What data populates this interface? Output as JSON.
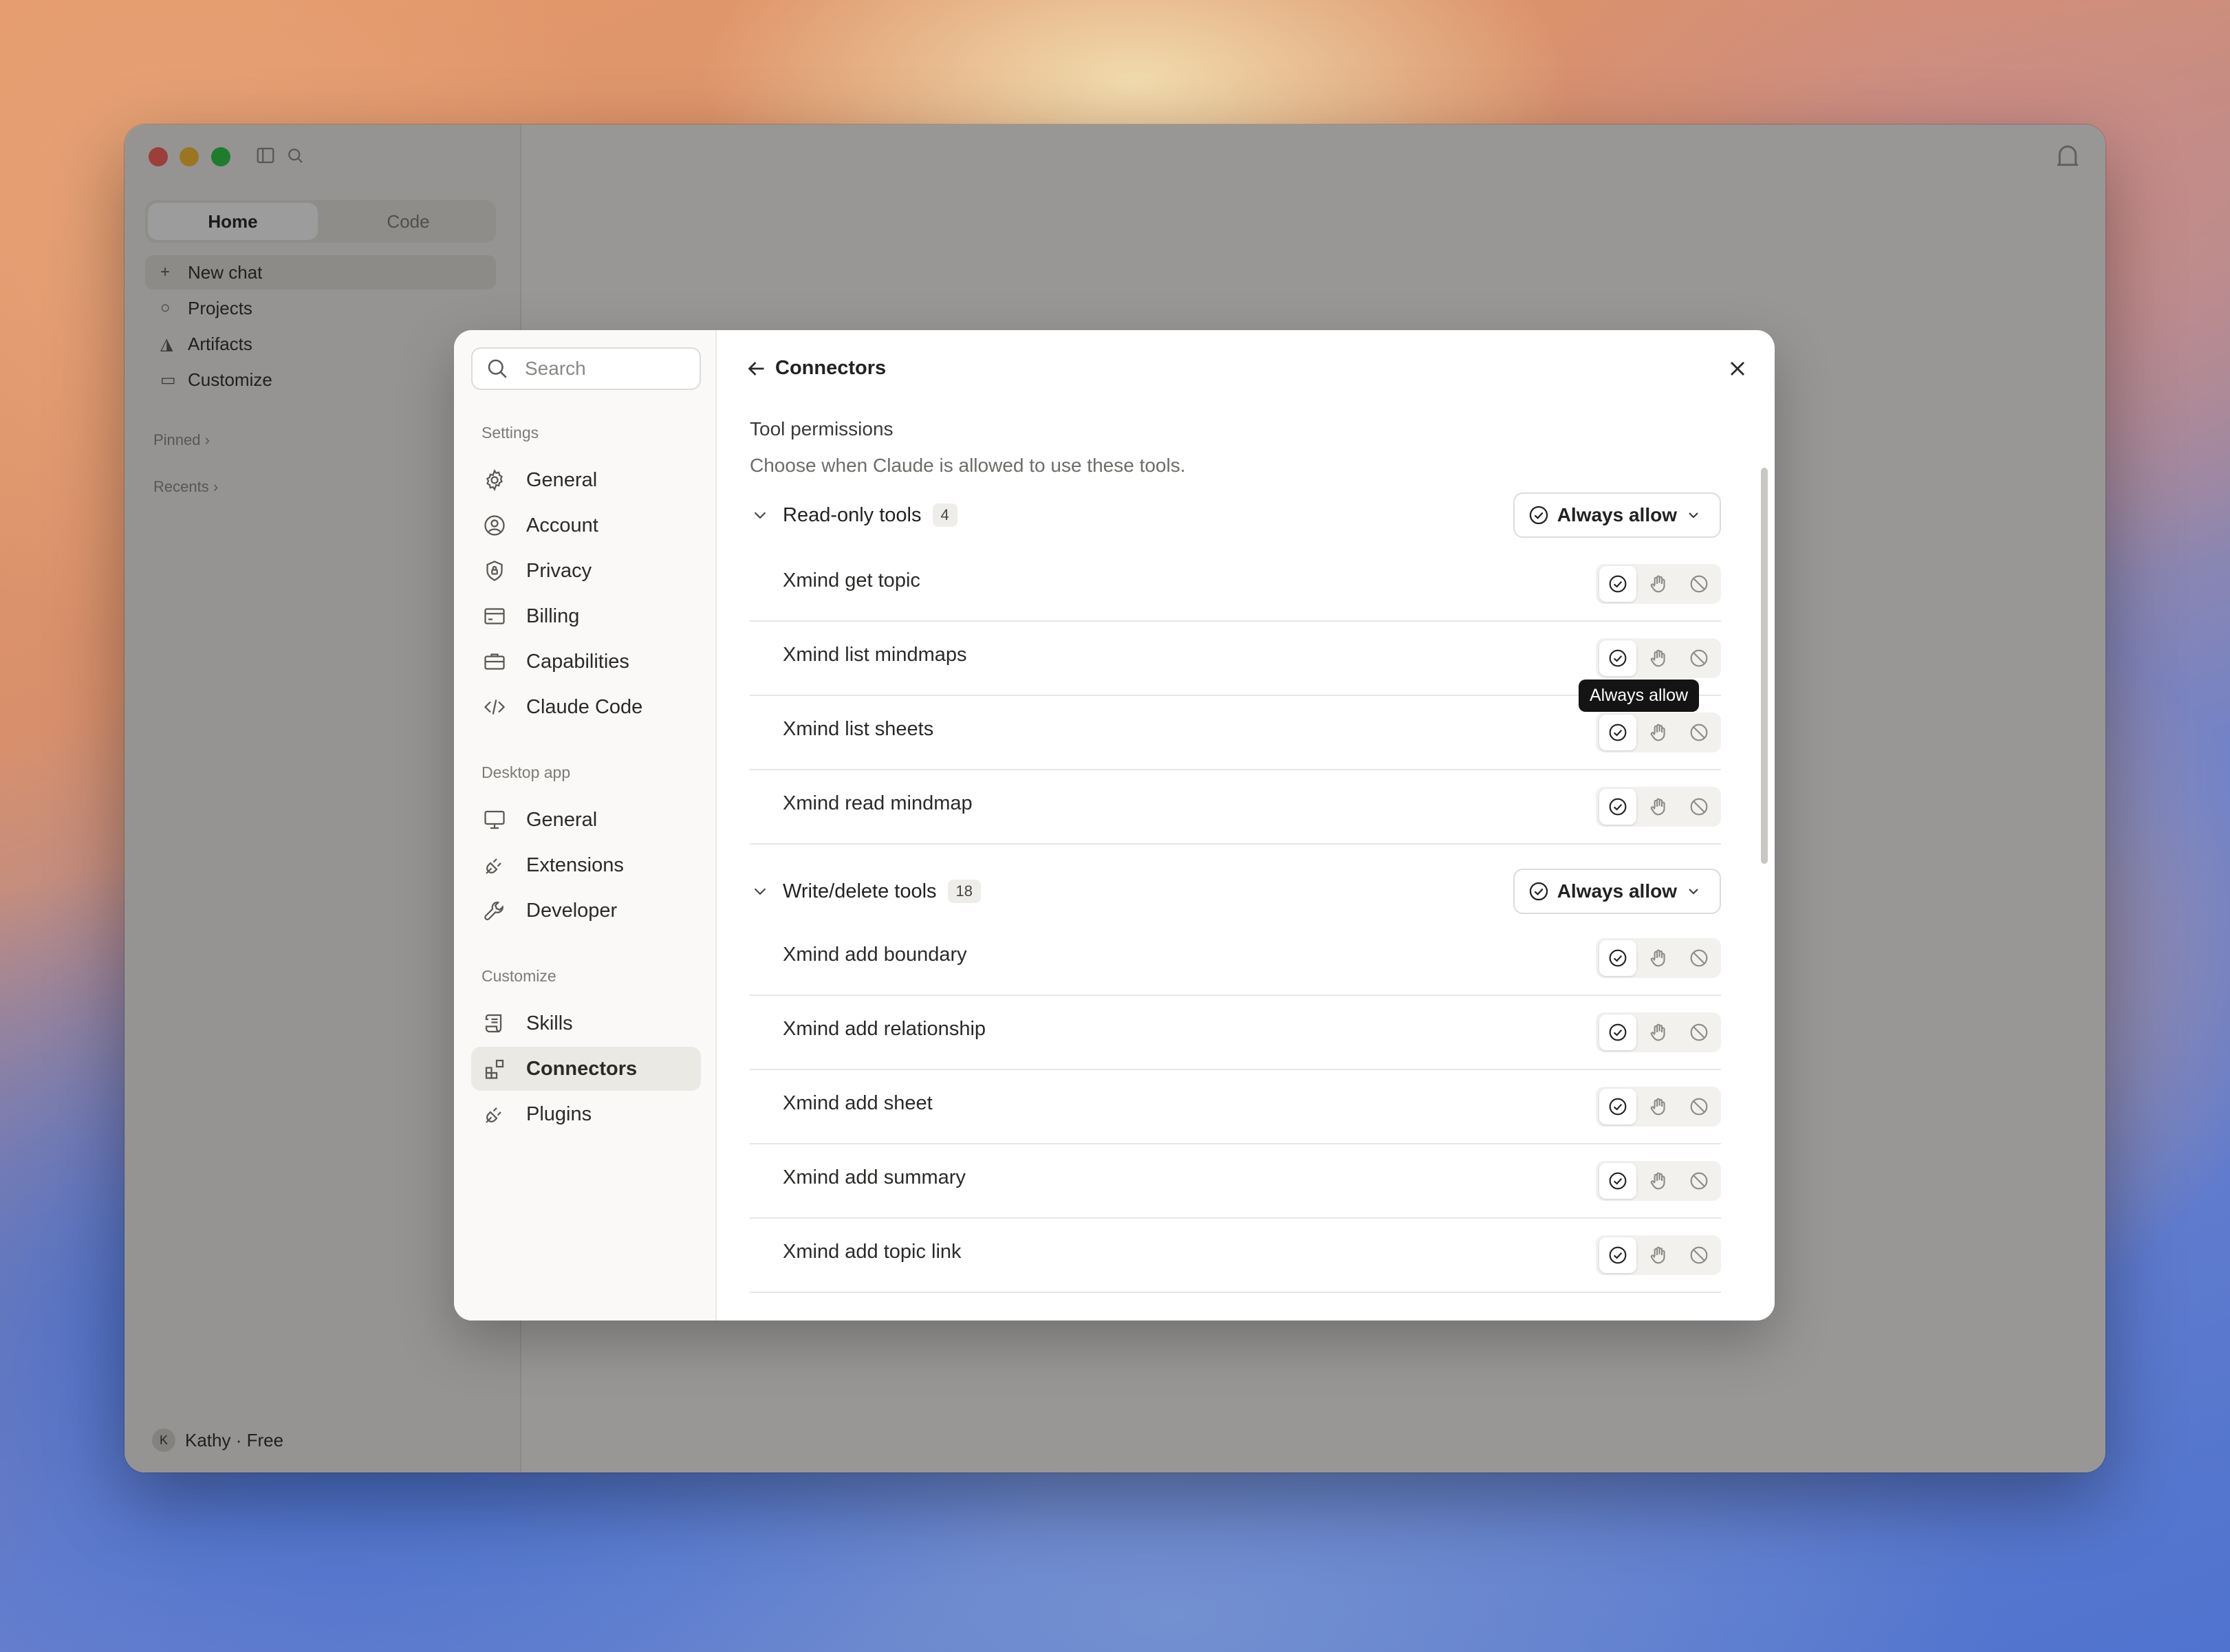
{
  "window": {
    "mode_tabs": [
      "Home",
      "Code"
    ],
    "nav": [
      "New chat",
      "Projects",
      "Artifacts",
      "Customize"
    ],
    "sections": [
      "Pinned",
      "Recents"
    ],
    "user": {
      "initial": "K",
      "name": "Kathy · Free"
    }
  },
  "settings_nav": {
    "search_placeholder": "Search",
    "sections": [
      {
        "label": "Settings",
        "items": [
          {
            "label": "General",
            "icon": "gear-icon"
          },
          {
            "label": "Account",
            "icon": "user-circle-icon"
          },
          {
            "label": "Privacy",
            "icon": "shield-lock-icon"
          },
          {
            "label": "Billing",
            "icon": "credit-card-icon"
          },
          {
            "label": "Capabilities",
            "icon": "briefcase-icon"
          },
          {
            "label": "Claude Code",
            "icon": "code-icon"
          }
        ]
      },
      {
        "label": "Desktop app",
        "items": [
          {
            "label": "General",
            "icon": "monitor-icon"
          },
          {
            "label": "Extensions",
            "icon": "plug-icon"
          },
          {
            "label": "Developer",
            "icon": "wrench-icon"
          }
        ]
      },
      {
        "label": "Customize",
        "items": [
          {
            "label": "Skills",
            "icon": "scroll-icon"
          },
          {
            "label": "Connectors",
            "icon": "connectors-icon",
            "active": true
          },
          {
            "label": "Plugins",
            "icon": "plug-icon"
          }
        ]
      }
    ]
  },
  "main": {
    "title": "Connectors",
    "section_title": "Tool permissions",
    "section_subtitle": "Choose when Claude is allowed to use these tools.",
    "groups": [
      {
        "title": "Read-only tools",
        "count": "4",
        "policy": "Always allow",
        "tools": [
          "Xmind get topic",
          "Xmind list mindmaps",
          "Xmind list sheets",
          "Xmind read mindmap"
        ]
      },
      {
        "title": "Write/delete tools",
        "count": "18",
        "policy": "Always allow",
        "tools": [
          "Xmind add boundary",
          "Xmind add relationship",
          "Xmind add sheet",
          "Xmind add summary",
          "Xmind add topic link"
        ]
      }
    ],
    "tooltip": "Always allow"
  }
}
